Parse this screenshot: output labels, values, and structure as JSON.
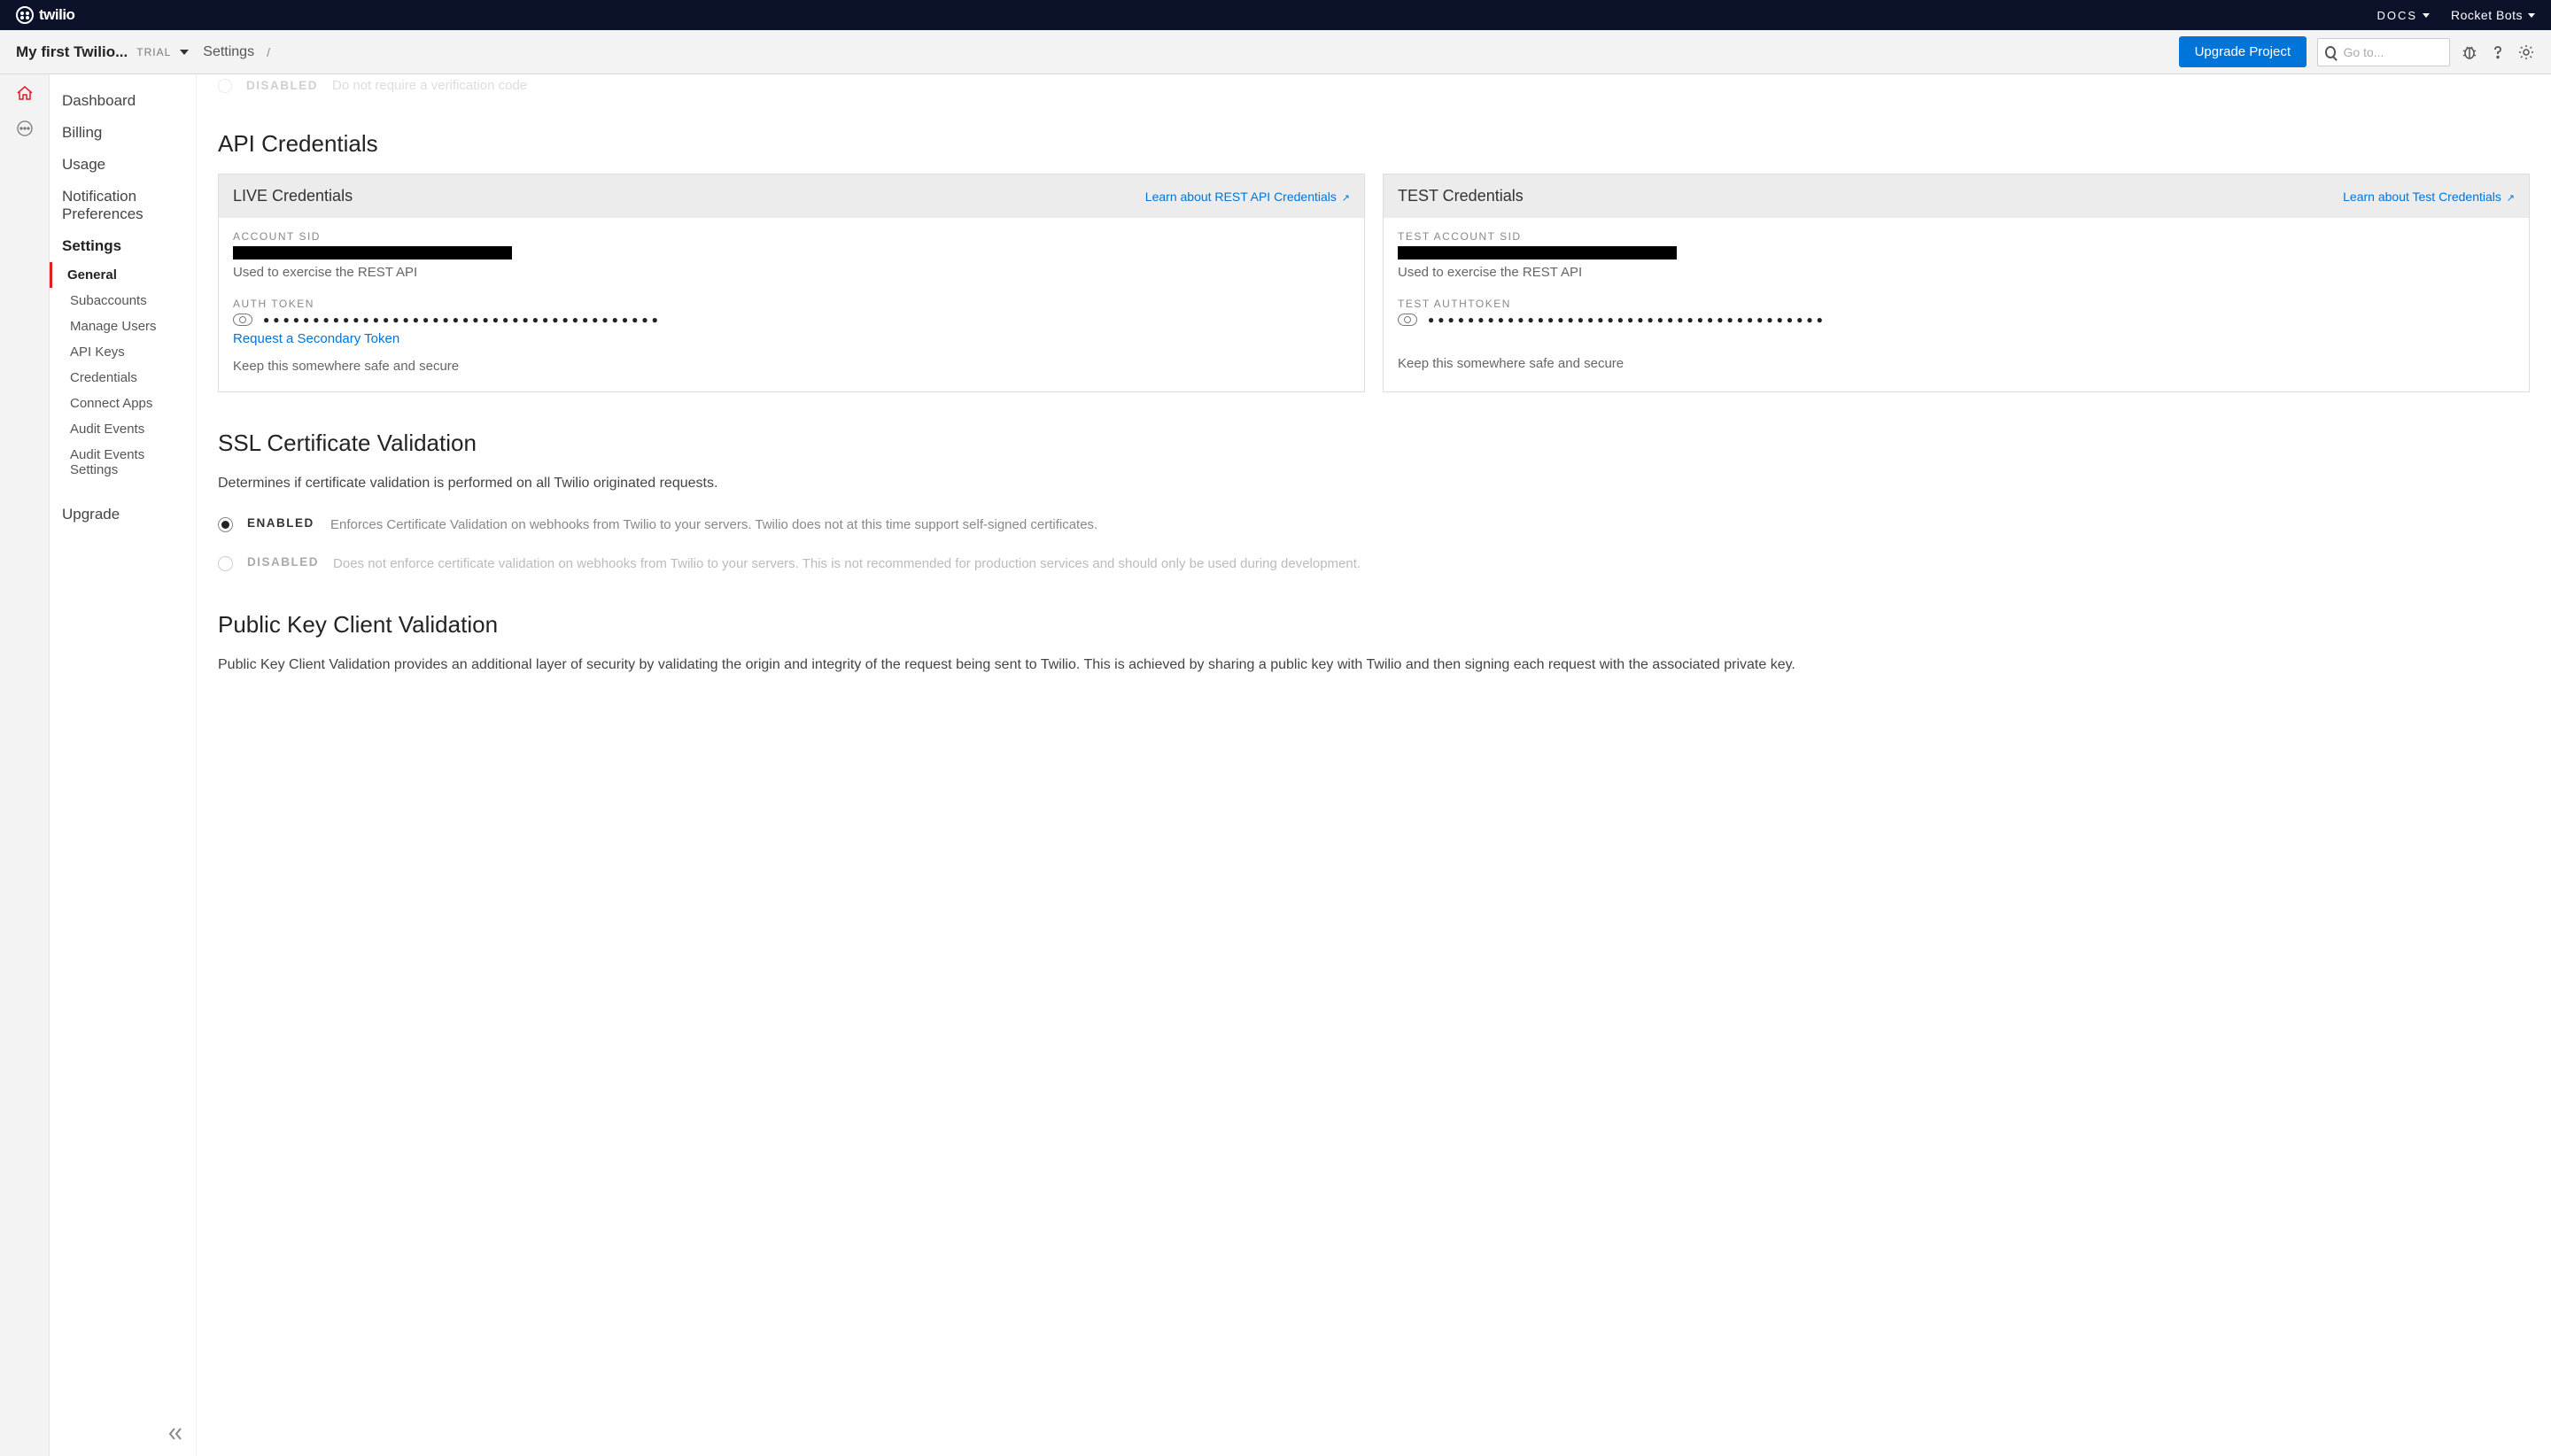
{
  "topbar": {
    "logo_text": "twilio",
    "docs_label": "DOCS",
    "account_label": "Rocket Bots"
  },
  "subheader": {
    "project_name": "My first Twilio...",
    "trial_badge": "TRIAL",
    "breadcrumb_settings": "Settings",
    "breadcrumb_sep": "/",
    "upgrade_button": "Upgrade Project",
    "search_placeholder": "Go to..."
  },
  "sidebar": {
    "items": [
      "Dashboard",
      "Billing",
      "Usage",
      "Notification Preferences",
      "Settings"
    ],
    "sub_items": [
      "General",
      "Subaccounts",
      "Manage Users",
      "API Keys",
      "Credentials",
      "Connect Apps",
      "Audit Events",
      "Audit Events Settings"
    ],
    "upgrade": "Upgrade"
  },
  "cutoff": {
    "label": "DISABLED",
    "desc": "Do not require a verification code"
  },
  "api_credentials": {
    "title": "API Credentials",
    "live": {
      "header": "LIVE Credentials",
      "learn_link": "Learn about REST API Credentials",
      "account_sid_label": "ACCOUNT SID",
      "account_sid_help": "Used to exercise the REST API",
      "auth_token_label": "AUTH TOKEN",
      "dots": "●●●●●●●●●●●●●●●●●●●●●●●●●●●●●●●●●●●●●●●●",
      "secondary_link": "Request a Secondary Token",
      "safe_help": "Keep this somewhere safe and secure"
    },
    "test": {
      "header": "TEST Credentials",
      "learn_link": "Learn about Test Credentials",
      "account_sid_label": "TEST ACCOUNT SID",
      "account_sid_help": "Used to exercise the REST API",
      "auth_token_label": "TEST AUTHTOKEN",
      "dots": "●●●●●●●●●●●●●●●●●●●●●●●●●●●●●●●●●●●●●●●●",
      "safe_help": "Keep this somewhere safe and secure"
    }
  },
  "ssl": {
    "title": "SSL Certificate Validation",
    "desc": "Determines if certificate validation is performed on all Twilio originated requests.",
    "enabled_label": "ENABLED",
    "enabled_desc": "Enforces Certificate Validation on webhooks from Twilio to your servers. Twilio does not at this time support self-signed certificates.",
    "disabled_label": "DISABLED",
    "disabled_desc": "Does not enforce certificate validation on webhooks from Twilio to your servers. This is not recommended for production services and should only be used during development."
  },
  "pkcv": {
    "title": "Public Key Client Validation",
    "desc": "Public Key Client Validation provides an additional layer of security by validating the origin and integrity of the request being sent to Twilio. This is achieved by sharing a public key with Twilio and then signing each request with the associated private key."
  }
}
